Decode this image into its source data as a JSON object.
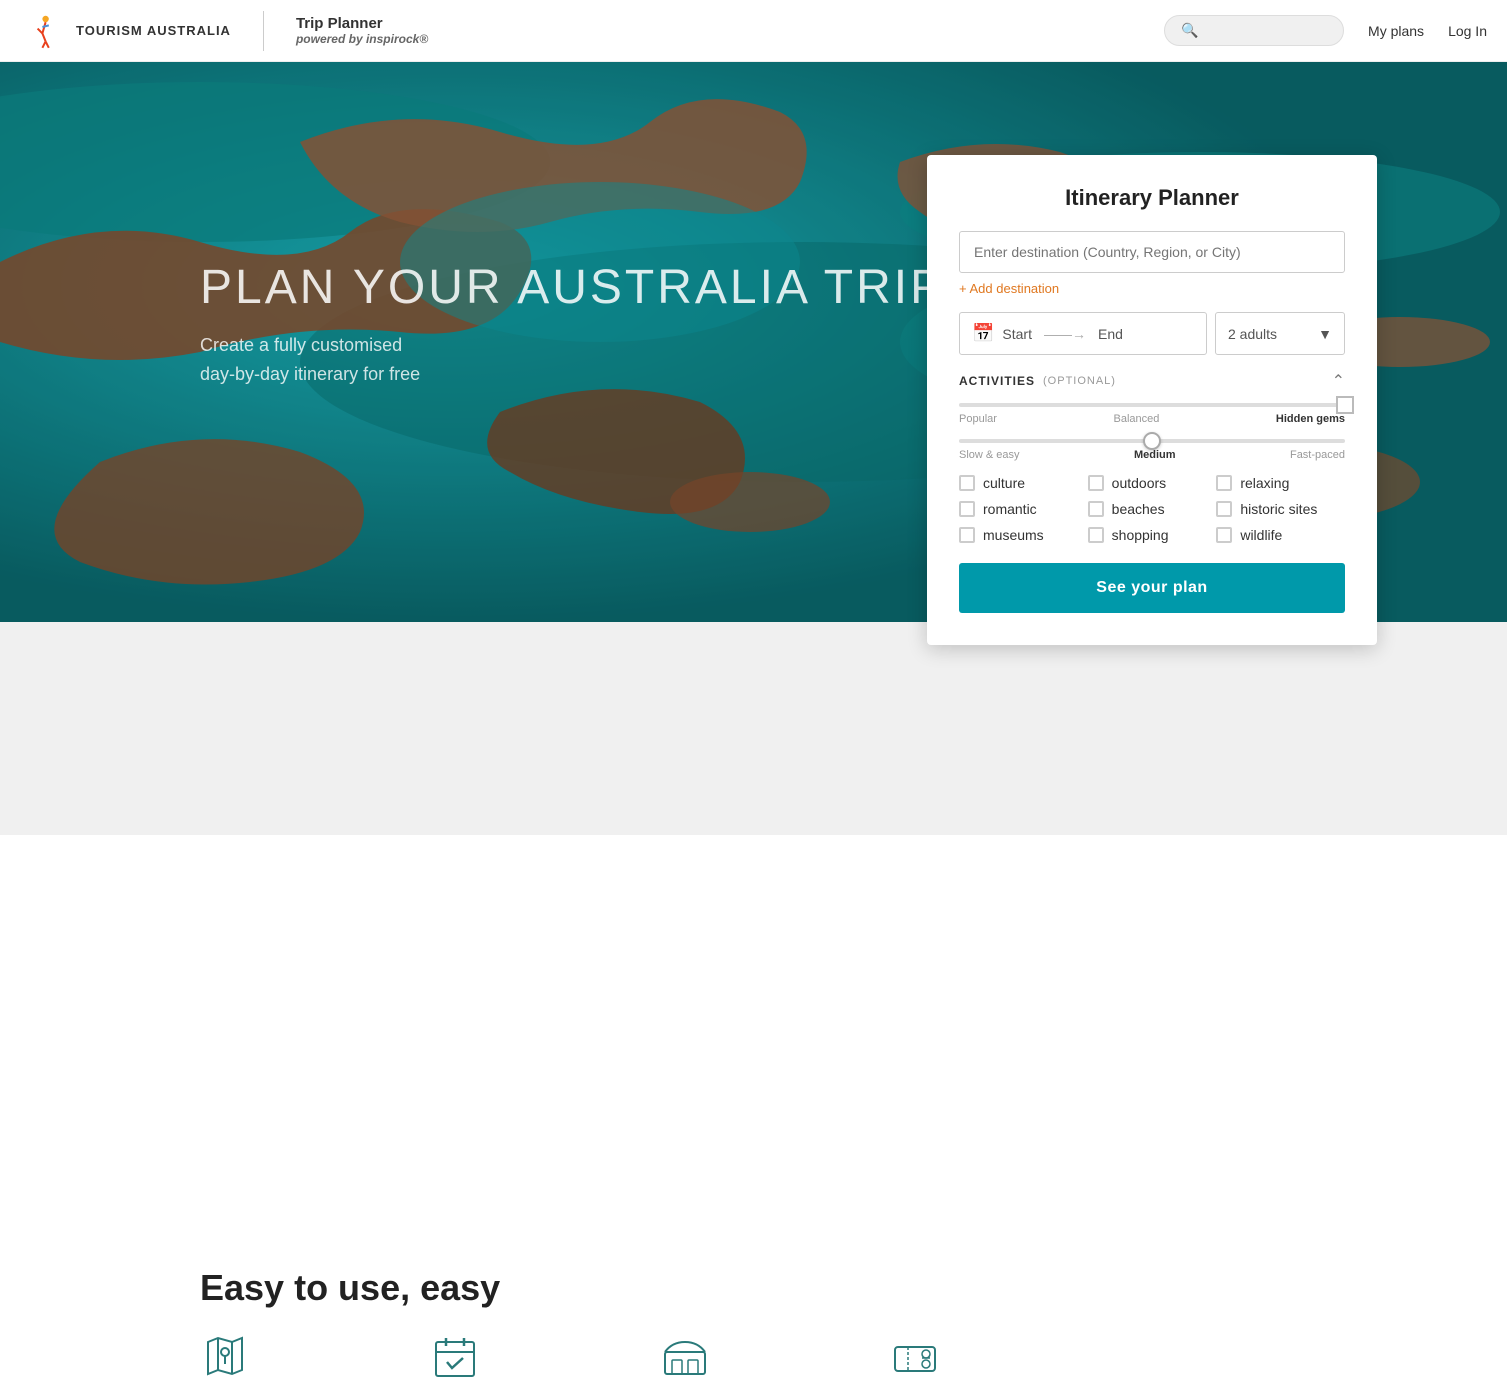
{
  "header": {
    "logo_text": "TOURISM AUSTRALIA",
    "trip_planner_title": "Trip Planner",
    "powered_by_prefix": "powered by ",
    "powered_by_brand": "inspir",
    "powered_by_suffix": "ock",
    "powered_by_reg": "®",
    "search_placeholder": "",
    "nav_my_plans": "My plans",
    "nav_login": "Log In"
  },
  "hero": {
    "title": "PLAN YOUR AUSTRALIA TRIP",
    "subtitle_line1": "Create a fully customised",
    "subtitle_line2": "day-by-day itinerary for free"
  },
  "below_hero": {
    "easy_to_use_text": "Easy to use, easy"
  },
  "planner": {
    "title": "Itinerary Planner",
    "destination_placeholder": "Enter destination (Country, Region, or City)",
    "add_destination": "+ Add destination",
    "date_start": "Start",
    "date_end": "End",
    "adults_value": "2 adults",
    "activities_label": "ACTIVITIES",
    "optional_label": "(OPTIONAL)",
    "slider1": {
      "left": "Popular",
      "middle": "Balanced",
      "right": "Hidden gems",
      "position": 100
    },
    "slider2": {
      "left": "Slow & easy",
      "middle": "Medium",
      "right": "Fast-paced",
      "position": 50
    },
    "checkboxes": [
      {
        "id": "culture",
        "label": "culture",
        "checked": false
      },
      {
        "id": "outdoors",
        "label": "outdoors",
        "checked": false
      },
      {
        "id": "relaxing",
        "label": "relaxing",
        "checked": false
      },
      {
        "id": "romantic",
        "label": "romantic",
        "checked": false
      },
      {
        "id": "beaches",
        "label": "beaches",
        "checked": false
      },
      {
        "id": "historic_sites",
        "label": "historic sites",
        "checked": false
      },
      {
        "id": "museums",
        "label": "museums",
        "checked": false
      },
      {
        "id": "shopping",
        "label": "shopping",
        "checked": false
      },
      {
        "id": "wildlife",
        "label": "wildlife",
        "checked": false
      }
    ],
    "see_plan_button": "See your plan"
  }
}
